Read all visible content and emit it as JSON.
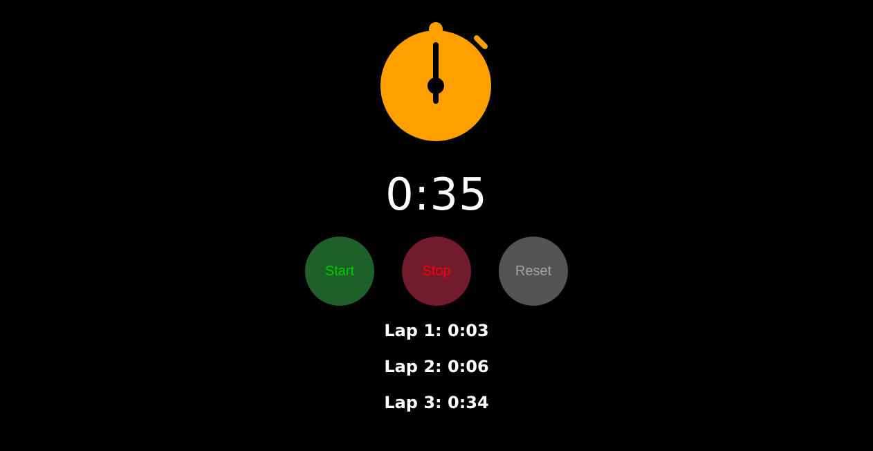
{
  "colors": {
    "background": "#000000",
    "stopwatch": "#ff9f00",
    "start_bg": "#1f5f2a",
    "start_text": "#00cc00",
    "stop_bg": "#731a2c",
    "stop_text": "#ff0000",
    "reset_bg": "#545454",
    "reset_text": "#a3a3a3"
  },
  "icon": "stopwatch-icon",
  "display": {
    "time": "0:35"
  },
  "controls": {
    "start_label": "Start",
    "stop_label": "Stop",
    "reset_label": "Reset"
  },
  "laps": [
    {
      "label": "Lap 1: 0:03"
    },
    {
      "label": "Lap 2: 0:06"
    },
    {
      "label": "Lap 3: 0:34"
    }
  ]
}
